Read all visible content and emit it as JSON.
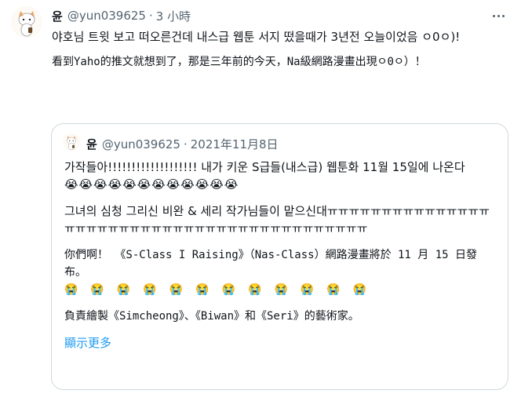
{
  "tweet": {
    "name": "윤",
    "handle": "@yun039625",
    "dot": "·",
    "time": "3 小時",
    "text_ko": "야호님 트윗 보고 떠오른건데 내스급 웹툰 서지 떴을때가 3년전 오늘이었음 ㅇ0ㅇ)!",
    "text_zh": "看到Yaho的推文就想到了，那是三年前的今天，Na級網路漫畫出現ㅇ0ㅇ）！"
  },
  "quote": {
    "name": "윤",
    "handle": "@yun039625",
    "dot": "·",
    "date": "2021年11月8日",
    "line1": "가작들아!!!!!!!!!!!!!!!!!!! 내가 키운 S급들(내스급) 웹툰화 11월 15일에 나온다",
    "emoji_row1": "😭😭😭😭😭😭😭😭😭😭😭😭",
    "line2": "그녀의 심청 그리신 비완 & 세리 작가님들이 맡으신대ㅠㅠㅠㅠㅠㅠㅠㅠㅠㅠㅠㅠㅠㅠㅠㅠㅠㅠㅠㅠㅠㅠㅠㅠㅠㅠㅠㅠㅠㅠㅠㅠㅠㅠㅠㅠㅠㅠㅠㅠㅠㅠㅠ",
    "line3": "你們啊！ 《S-Class I Raising》（Nas-Class）網路漫畫將於 11 月 15 日發布。",
    "emoji_row2": "😭😭😭😭😭😭😭😭😭😭😭😭",
    "line4": "負責繪製《Simcheong》、《Biwan》和《Seri》的藝術家。",
    "show_more": "顯示更多"
  },
  "icons": {
    "more": "more-options-icon",
    "avatar": "cat-avatar-icon"
  }
}
